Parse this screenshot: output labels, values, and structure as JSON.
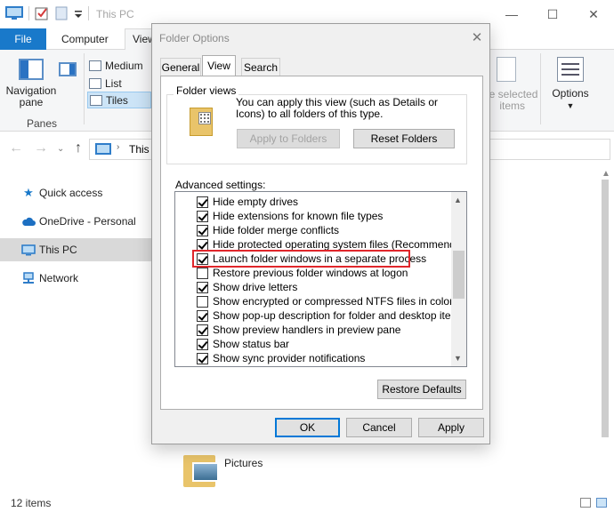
{
  "explorer": {
    "title": "This PC",
    "ribbon_tabs": {
      "file": "File",
      "computer": "Computer",
      "view": "View"
    },
    "ribbon": {
      "navigation_pane": "Navigation\npane",
      "panes_group": "Panes",
      "layout_items": [
        "Medium",
        "List",
        "Tiles"
      ],
      "show_selected_items": "le selected\nitems",
      "options": "Options"
    },
    "address": {
      "crumb": "This"
    },
    "sidebar": {
      "items": [
        {
          "label": "Quick access",
          "icon": "star-icon",
          "selected": false
        },
        {
          "label": "OneDrive - Personal",
          "icon": "cloud-icon",
          "selected": false
        },
        {
          "label": "This PC",
          "icon": "computer-icon",
          "selected": true
        },
        {
          "label": "Network",
          "icon": "network-icon",
          "selected": false
        }
      ]
    },
    "content": {
      "folder_pictures": "Pictures"
    },
    "status": {
      "items_count": "12 items"
    },
    "colors": {
      "file_tab": "#1979ca",
      "selected_nav": "#d9d9d9"
    }
  },
  "dialog": {
    "title": "Folder Options",
    "tabs": [
      "General",
      "View",
      "Search"
    ],
    "active_tab": "View",
    "folder_views": {
      "label": "Folder views",
      "description": "You can apply this view (such as Details or Icons) to all folders of this type.",
      "apply_button": "Apply to Folders",
      "reset_button": "Reset Folders"
    },
    "advanced_label": "Advanced settings:",
    "advanced_items": [
      {
        "label": "Hide empty drives",
        "checked": true
      },
      {
        "label": "Hide extensions for known file types",
        "checked": true
      },
      {
        "label": "Hide folder merge conflicts",
        "checked": true
      },
      {
        "label": "Hide protected operating system files (Recommended)",
        "checked": true
      },
      {
        "label": "Launch folder windows in a separate process",
        "checked": true,
        "highlighted": true
      },
      {
        "label": "Restore previous folder windows at logon",
        "checked": false
      },
      {
        "label": "Show drive letters",
        "checked": true
      },
      {
        "label": "Show encrypted or compressed NTFS files in color",
        "checked": false
      },
      {
        "label": "Show pop-up description for folder and desktop items",
        "checked": true
      },
      {
        "label": "Show preview handlers in preview pane",
        "checked": true
      },
      {
        "label": "Show status bar",
        "checked": true
      },
      {
        "label": "Show sync provider notifications",
        "checked": true
      }
    ],
    "restore_defaults": "Restore Defaults",
    "ok": "OK",
    "cancel": "Cancel",
    "apply": "Apply",
    "colors": {
      "highlight": "#e0262b",
      "default_button_border": "#0078d7"
    }
  }
}
